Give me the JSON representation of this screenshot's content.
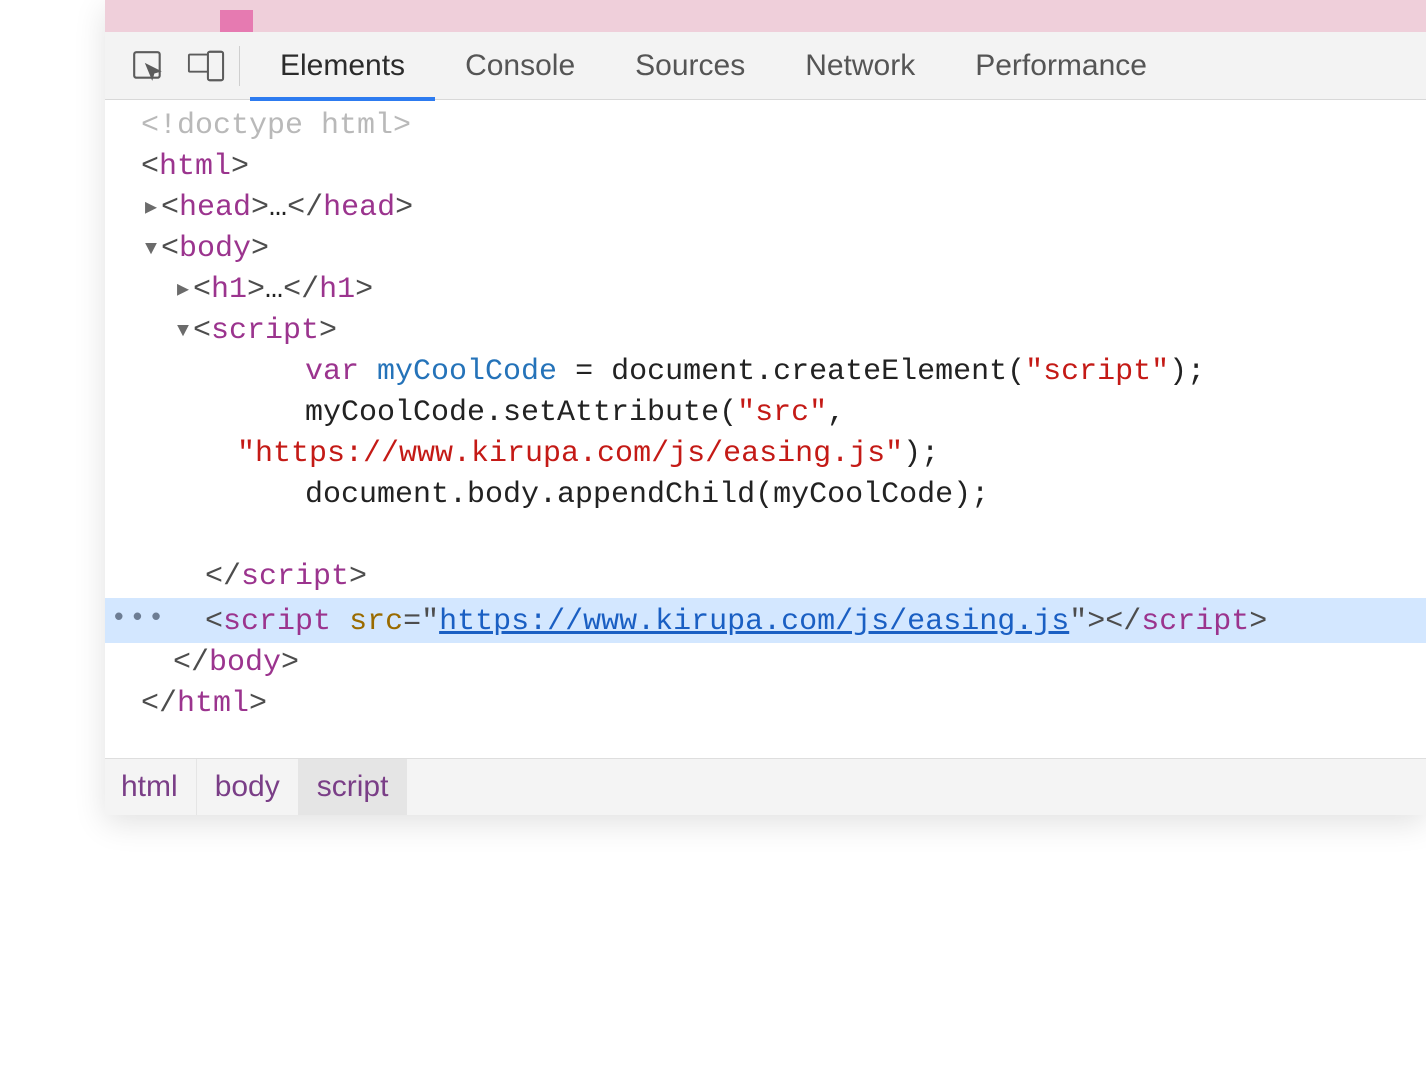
{
  "tab_bar": {
    "dummy": ""
  },
  "tabs": {
    "elements": "Elements",
    "console": "Console",
    "sources": "Sources",
    "network": "Network",
    "performance": "Performance"
  },
  "dom": {
    "doctype": "<!doctype html>",
    "html_open": "html",
    "head": {
      "tag": "head",
      "ellipsis": "…"
    },
    "body": {
      "tag": "body"
    },
    "h1": {
      "tag": "h1",
      "ellipsis": "…"
    },
    "script_open": "script",
    "code": {
      "l1_prefix": "        ",
      "l1_kw": "var",
      "l1_var": "myCoolCode",
      "l1_eq": " = document.createElement(",
      "l1_str": "\"script\"",
      "l1_end": ");",
      "l2_prefix": "        ",
      "l2_call": "myCoolCode.setAttribute(",
      "l2_str": "\"src\"",
      "l2_end": ",",
      "l3_prefix": "",
      "l3_str": "\"https://www.kirupa.com/js/easing.js\"",
      "l3_end": ");",
      "l4_prefix": "        ",
      "l4_call": "document.body.appendChild(myCoolCode);"
    },
    "script_close": "script",
    "sel": {
      "gutter": "•••",
      "tag": "script",
      "attr": "src",
      "eq": "=",
      "q": "\"",
      "url": "https://www.kirupa.com/js/easing.js",
      "close_tag": "script"
    },
    "body_close": "body",
    "html_close": "html"
  },
  "breadcrumbs": {
    "html": "html",
    "body": "body",
    "script": "script"
  }
}
